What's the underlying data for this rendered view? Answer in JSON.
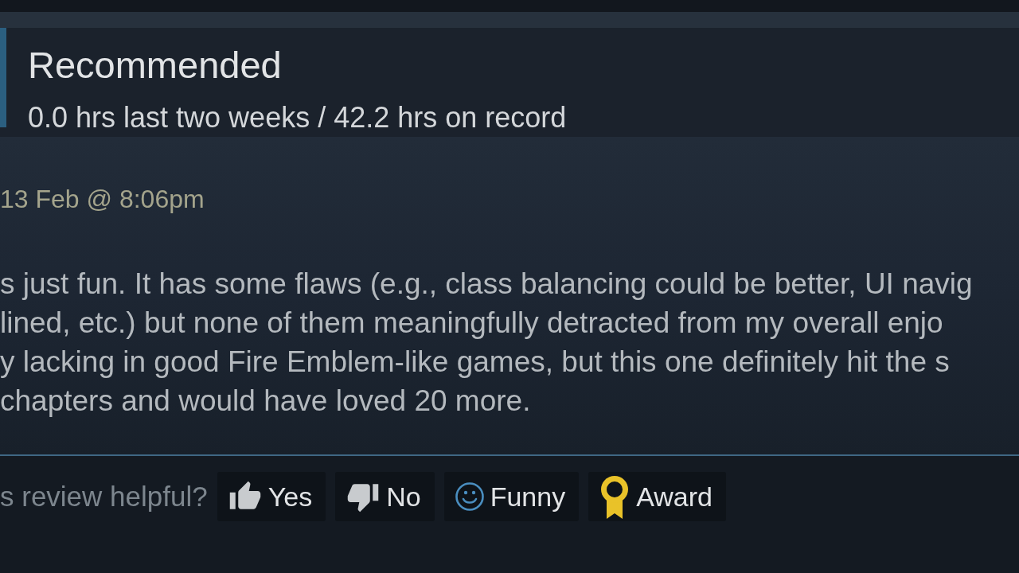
{
  "review": {
    "verdict": "Recommended",
    "hours": "0.0 hrs last two weeks / 42.2 hrs on record",
    "posted": "13 Feb @ 8:06pm",
    "body_lines": [
      "s just fun. It has some flaws (e.g., class balancing could be better, UI navig",
      "lined, etc.) but none of them meaningfully detracted from my overall enjo",
      "y lacking in good Fire Emblem-like games, but this one definitely hit the s",
      "chapters and would have loved 20 more."
    ]
  },
  "helpful": {
    "prompt": "s review helpful?",
    "buttons": [
      {
        "kind": "up",
        "label": "Yes"
      },
      {
        "kind": "down",
        "label": "No"
      },
      {
        "kind": "funny",
        "label": "Funny"
      },
      {
        "kind": "award",
        "label": "Award"
      }
    ]
  }
}
